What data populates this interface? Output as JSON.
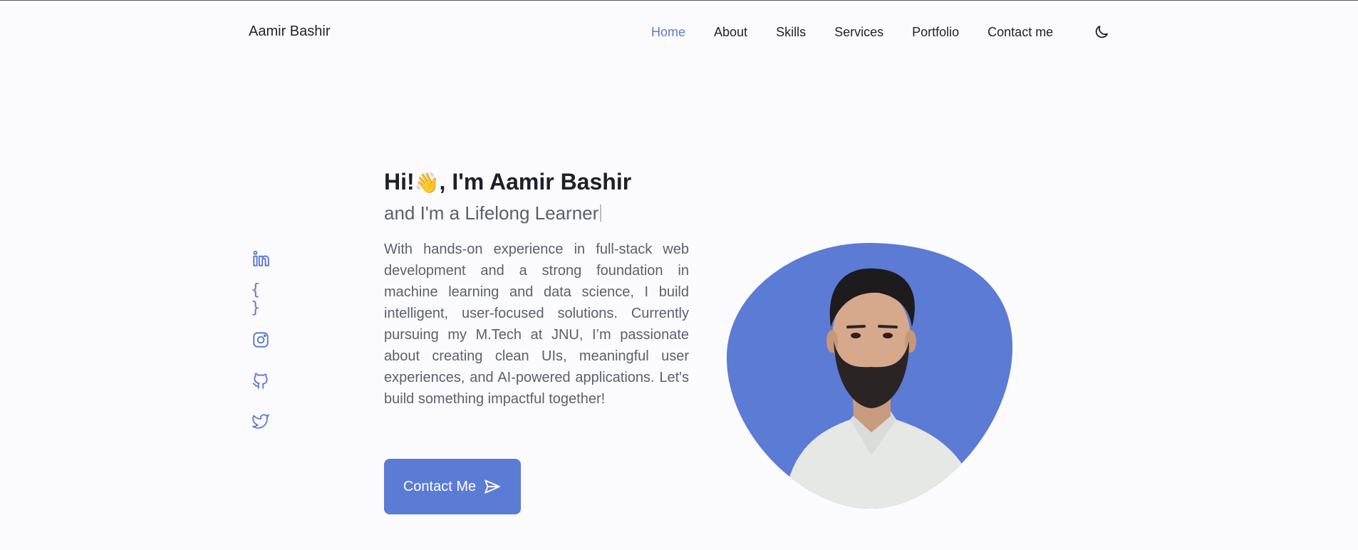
{
  "header": {
    "logo": "Aamir Bashir",
    "nav": [
      "Home",
      "About",
      "Skills",
      "Services",
      "Portfolio",
      "Contact me"
    ],
    "active_nav": "Home",
    "theme_toggle_icon": "moon-icon"
  },
  "social": {
    "icons": [
      "linkedin-icon",
      "braces-icon",
      "instagram-icon",
      "github-icon",
      "twitter-icon"
    ],
    "braces_text": "{ }"
  },
  "hero": {
    "title_prefix": "Hi!",
    "wave_emoji": "👋",
    "title_suffix": ", I'm Aamir Bashir",
    "subtitle": "and I'm a Lifelong Learner",
    "description": "With hands-on experience in full-stack web development and a strong foundation in machine learning and data science, I build intelligent, user-focused solutions. Currently pursuing my M.Tech at JNU, I’m passionate about creating clean UIs, meaningful user experiences, and AI-powered applications. Let's build something impactful together!",
    "cta_label": "Contact Me"
  },
  "colors": {
    "accent": "#5b7bd5",
    "background": "#fbfbfd",
    "text": "#1f1f2b",
    "muted": "#5c5f6e"
  }
}
